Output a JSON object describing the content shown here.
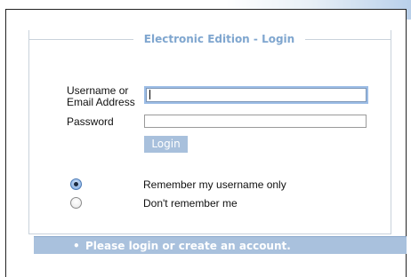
{
  "login_form": {
    "legend": "Electronic Edition - Login",
    "username_label_line1": "Username or",
    "username_label_line2": "Email Address",
    "username_value": "",
    "password_label": "Password",
    "password_value": "",
    "login_button": "Login",
    "remember_options": [
      {
        "label": "Remember my username only",
        "checked": true
      },
      {
        "label": "Don't remember me",
        "checked": false
      }
    ]
  },
  "status_bar": {
    "bullet": "•",
    "message": "Please login or create an account."
  },
  "colors": {
    "accent": "#7fa6cf",
    "button_bg": "#a8c0dc",
    "status_bg": "#a9c1dd"
  }
}
